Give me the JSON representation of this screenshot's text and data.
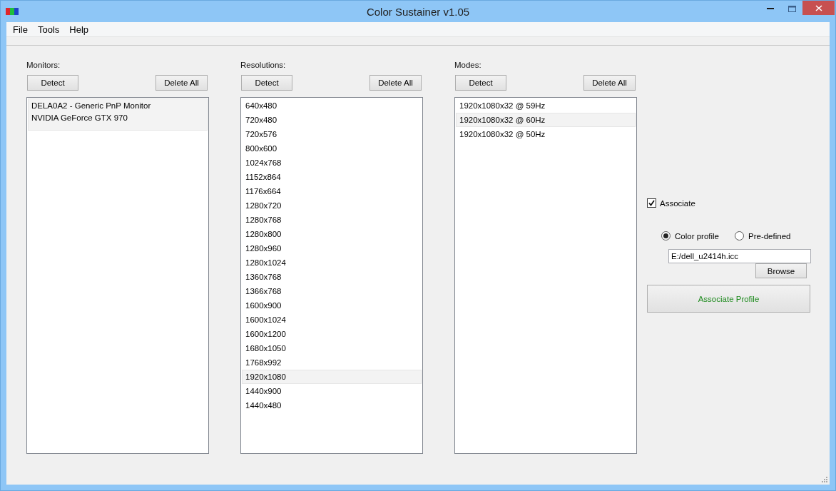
{
  "window": {
    "title": "Color Sustainer v1.05"
  },
  "menu": [
    "File",
    "Tools",
    "Help"
  ],
  "panels": [
    {
      "label": "Monitors:",
      "detect": "Detect",
      "delete_all": "Delete All",
      "items": [
        {
          "lines": [
            "DELA0A2 - Generic PnP Monitor",
            "NVIDIA GeForce GTX 970"
          ],
          "selected": true
        }
      ]
    },
    {
      "label": "Resolutions:",
      "detect": "Detect",
      "delete_all": "Delete All",
      "items": [
        {
          "lines": [
            "640x480"
          ],
          "selected": false
        },
        {
          "lines": [
            "720x480"
          ],
          "selected": false
        },
        {
          "lines": [
            "720x576"
          ],
          "selected": false
        },
        {
          "lines": [
            "800x600"
          ],
          "selected": false
        },
        {
          "lines": [
            "1024x768"
          ],
          "selected": false
        },
        {
          "lines": [
            "1152x864"
          ],
          "selected": false
        },
        {
          "lines": [
            "1176x664"
          ],
          "selected": false
        },
        {
          "lines": [
            "1280x720"
          ],
          "selected": false
        },
        {
          "lines": [
            "1280x768"
          ],
          "selected": false
        },
        {
          "lines": [
            "1280x800"
          ],
          "selected": false
        },
        {
          "lines": [
            "1280x960"
          ],
          "selected": false
        },
        {
          "lines": [
            "1280x1024"
          ],
          "selected": false
        },
        {
          "lines": [
            "1360x768"
          ],
          "selected": false
        },
        {
          "lines": [
            "1366x768"
          ],
          "selected": false
        },
        {
          "lines": [
            "1600x900"
          ],
          "selected": false
        },
        {
          "lines": [
            "1600x1024"
          ],
          "selected": false
        },
        {
          "lines": [
            "1600x1200"
          ],
          "selected": false
        },
        {
          "lines": [
            "1680x1050"
          ],
          "selected": false
        },
        {
          "lines": [
            "1768x992"
          ],
          "selected": false
        },
        {
          "lines": [
            "1920x1080"
          ],
          "selected": true
        },
        {
          "lines": [
            "1440x900"
          ],
          "selected": false
        },
        {
          "lines": [
            "1440x480"
          ],
          "selected": false
        }
      ]
    },
    {
      "label": "Modes:",
      "detect": "Detect",
      "delete_all": "Delete All",
      "items": [
        {
          "lines": [
            "1920x1080x32 @ 59Hz"
          ],
          "selected": false
        },
        {
          "lines": [
            "1920x1080x32 @ 60Hz"
          ],
          "selected": true
        },
        {
          "lines": [
            "1920x1080x32 @ 50Hz"
          ],
          "selected": false
        }
      ]
    }
  ],
  "associate": {
    "label": "Associate",
    "checked": true
  },
  "profile_options": [
    {
      "label": "Color profile",
      "selected": true
    },
    {
      "label": "Pre-defined",
      "selected": false
    }
  ],
  "profile_path": {
    "value": "E:/dell_u2414h.icc"
  },
  "browse": "Browse",
  "associate_profile": "Associate Profile"
}
